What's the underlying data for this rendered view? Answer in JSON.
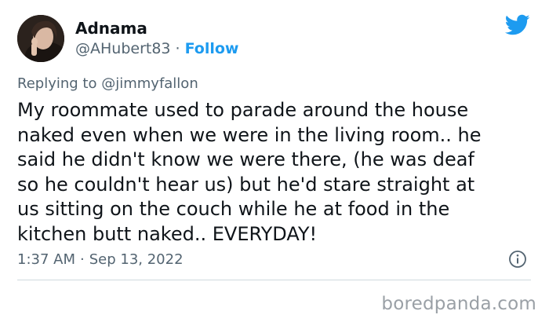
{
  "author": {
    "display_name": "Adnama",
    "handle": "@AHubert83",
    "separator": "·",
    "follow_label": "Follow"
  },
  "reply": {
    "prefix": "Replying to",
    "mention": "@jimmyfallon"
  },
  "tweet": {
    "text": "My roommate used to parade around the house\nnaked even when we were in the living room.. he\nsaid he didn't know we were there, (he was deaf\nso he couldn't hear us) but he'd stare straight at\nus sitting on the couch while he at food in the\nkitchen butt naked.. EVERYDAY!"
  },
  "meta": {
    "time": "1:37 AM",
    "separator": "·",
    "date": "Sep 13, 2022"
  },
  "watermark": {
    "text": "boredpanda.com"
  },
  "colors": {
    "accent": "#1d9bf0",
    "secondary_text": "#536471",
    "primary_text": "#0f1419",
    "divider": "#cfd9de",
    "watermark": "#9aa0a6"
  },
  "icons": {
    "brand": "twitter-bird-icon",
    "info": "info-icon"
  }
}
